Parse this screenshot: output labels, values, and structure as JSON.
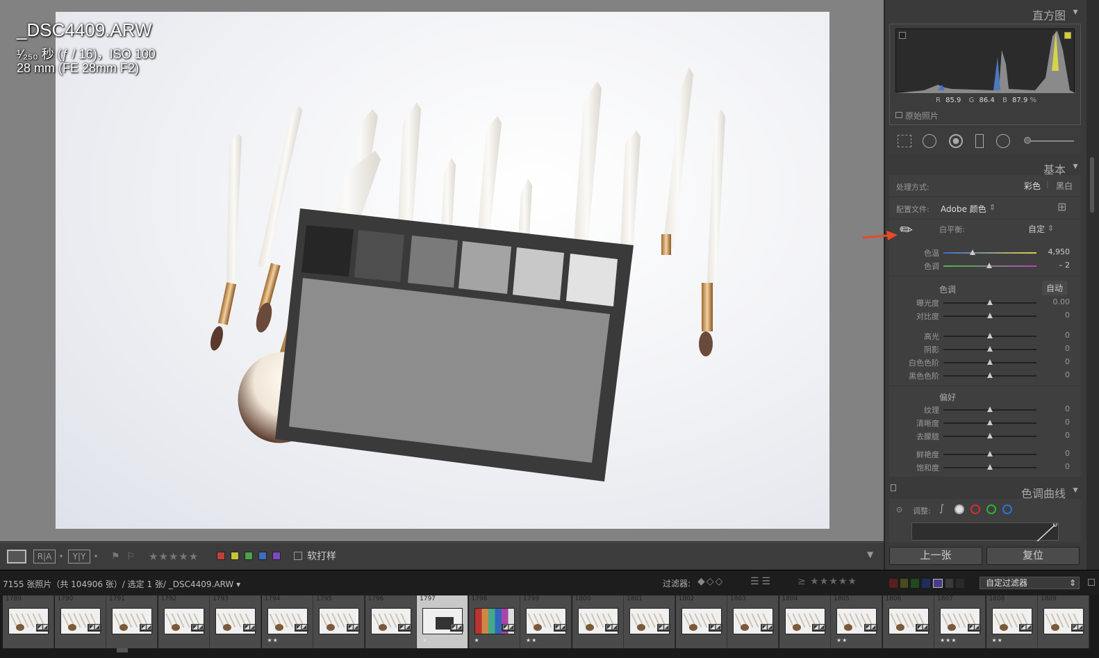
{
  "photo_info": {
    "filename": "_DSC4409.ARW",
    "exposure": "¹⁄₂₅₀ 秒 (ƒ / 16)，ISO 100",
    "lens": "28 mm (FE 28mm F2)"
  },
  "toolbar": {
    "soft_proof_label": "软打样"
  },
  "panels": {
    "histogram": {
      "title": "直方图",
      "r_label": "R",
      "r_value": "85.9",
      "g_label": "G",
      "g_value": "86.4",
      "b_label": "B",
      "b_value": "87.9",
      "unit": "%",
      "original_photo_label": "原始照片"
    },
    "basic": {
      "title": "基本",
      "treatment_label": "处理方式:",
      "color_label": "彩色",
      "bw_label": "黑白",
      "profile_label": "配置文件:",
      "profile_value": "Adobe 颜色",
      "wb_label": "白平衡:",
      "wb_value": "自定",
      "temp": {
        "label": "色温",
        "value": "4,950",
        "level": 0.31
      },
      "tint": {
        "label": "色调",
        "value": "– 2",
        "level": 0.49
      },
      "tone_header": "色调",
      "auto_label": "自动",
      "tone_sliders": [
        {
          "label": "曝光度",
          "value": "0.00",
          "level": 0.5
        },
        {
          "label": "对比度",
          "value": "0",
          "level": 0.5
        },
        {
          "label": "高光",
          "value": "0",
          "level": 0.5
        },
        {
          "label": "阴影",
          "value": "0",
          "level": 0.5
        },
        {
          "label": "白色色阶",
          "value": "0",
          "level": 0.5
        },
        {
          "label": "黑色色阶",
          "value": "0",
          "level": 0.5
        }
      ],
      "presence_header": "偏好",
      "presence_sliders": [
        {
          "label": "纹理",
          "value": "0",
          "level": 0.5
        },
        {
          "label": "清晰度",
          "value": "0",
          "level": 0.5
        },
        {
          "label": "去朦胧",
          "value": "0",
          "level": 0.5
        },
        {
          "label": "鲜艳度",
          "value": "0",
          "level": 0.5
        },
        {
          "label": "饱和度",
          "value": "0",
          "level": 0.5
        }
      ]
    },
    "tone_curve": {
      "title": "色调曲线",
      "adjust_label": "调整:"
    }
  },
  "buttons": {
    "previous": "上一张",
    "reset": "复位"
  },
  "status": {
    "text": "7155 张照片（共 104906 张）/ 选定 1 张/ _DSC4409.ARW ▾",
    "filter_label": "过滤器:",
    "filter_preset": "自定过滤器"
  },
  "filmstrip": [
    {
      "num": "1789",
      "stars": ""
    },
    {
      "num": "1790",
      "stars": ""
    },
    {
      "num": "1791",
      "stars": ""
    },
    {
      "num": "1792",
      "stars": ""
    },
    {
      "num": "1793",
      "stars": ""
    },
    {
      "num": "1794",
      "stars": "★★"
    },
    {
      "num": "1795",
      "stars": ""
    },
    {
      "num": "1796",
      "stars": ""
    },
    {
      "num": "1797",
      "stars": "★"
    },
    {
      "num": "1798",
      "stars": "★"
    },
    {
      "num": "1799",
      "stars": "★★"
    },
    {
      "num": "1800",
      "stars": ""
    },
    {
      "num": "1801",
      "stars": ""
    },
    {
      "num": "1802",
      "stars": ""
    },
    {
      "num": "1803",
      "stars": ""
    },
    {
      "num": "1804",
      "stars": ""
    },
    {
      "num": "1805",
      "stars": "★★"
    },
    {
      "num": "1806",
      "stars": ""
    },
    {
      "num": "1807",
      "stars": "★★★"
    },
    {
      "num": "1808",
      "stars": "★★"
    },
    {
      "num": "1809",
      "stars": ""
    }
  ],
  "colors": {
    "accent_arrow": "#e8492a",
    "label_red": "#c0413c",
    "label_yellow": "#c6c43c",
    "label_green": "#4aa24a",
    "label_blue": "#3c6ec0",
    "label_purple": "#7a4ac0"
  }
}
